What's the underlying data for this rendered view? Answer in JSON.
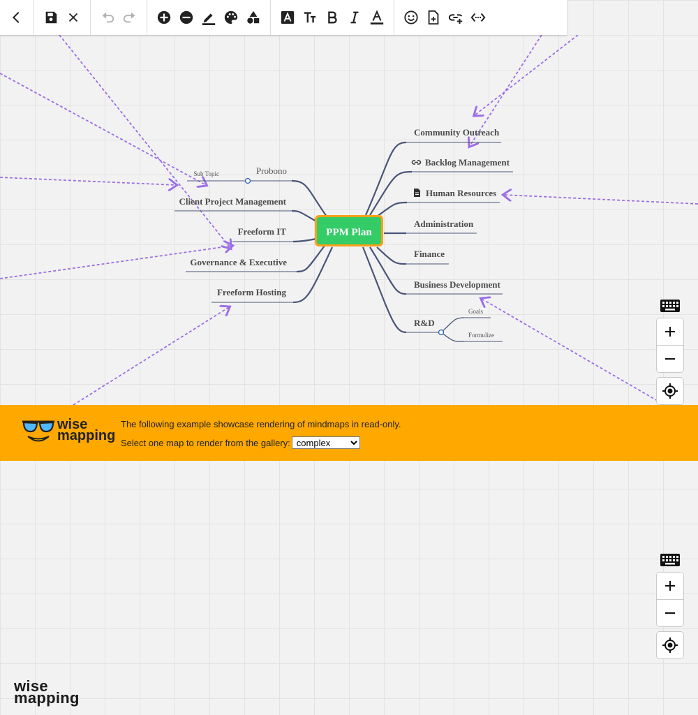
{
  "toolbar": {
    "groups": [
      [
        "back-arrow-icon"
      ],
      [
        "save-icon",
        "close-icon"
      ],
      [
        "undo-icon",
        "redo-icon"
      ],
      [
        "add-topic-icon",
        "remove-topic-icon",
        "border-style-icon",
        "palette-icon",
        "shapes-icon"
      ],
      [
        "font-color-box-icon",
        "font-size-icon",
        "bold-icon",
        "italic-icon",
        "text-color-icon"
      ],
      [
        "emoji-icon",
        "note-icon",
        "link-icon",
        "relationship-icon"
      ]
    ]
  },
  "mindmap": {
    "central": "PPM Plan",
    "central_color": "#33cc66",
    "central_border": "#f7a11a",
    "branch_color": "#4a5578",
    "relationship_color": "#9b6ee6",
    "left_topics": [
      "Probono",
      "Client Project Management",
      "Freeform IT",
      "Governance & Executive",
      "Freeform Hosting"
    ],
    "left_subtopics": [
      "Sub Topic"
    ],
    "right_topics": [
      "Community Outreach",
      "Backlog Management",
      "Human Resources",
      "Administration",
      "Finance",
      "Business Development",
      "R&D"
    ],
    "rnd_subtopics": [
      "Goals",
      "Formulize"
    ],
    "topic_icons": {
      "Backlog Management": "link-icon",
      "Human Resources": "note-icon"
    }
  },
  "banner": {
    "logo_text_1": "wise",
    "logo_text_2": "mapping",
    "line1": "The following example showcase rendering of mindmaps in read-only.",
    "line2_label": "Select one map to render from the gallery:",
    "select_value": "complex",
    "background": "#ffa800"
  },
  "footer": {
    "logo_text_1": "wise",
    "logo_text_2": "mapping"
  }
}
